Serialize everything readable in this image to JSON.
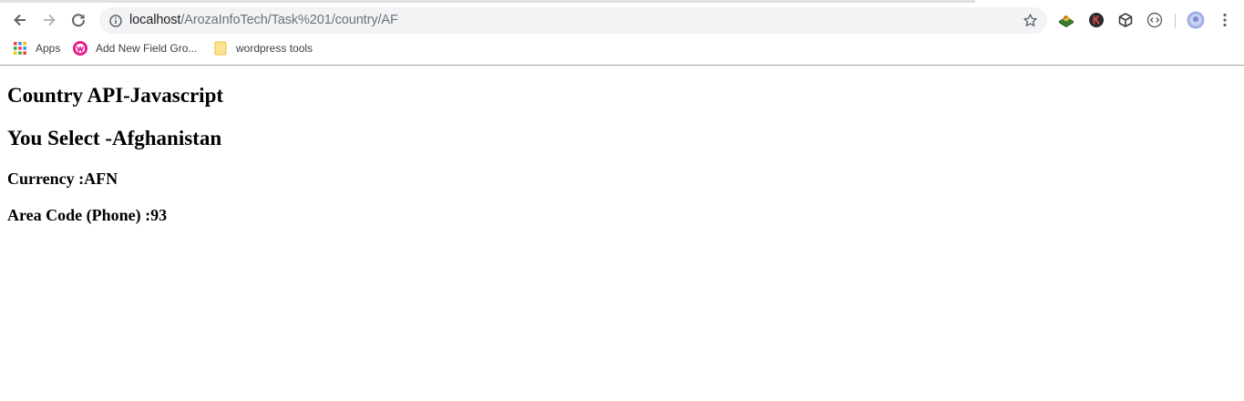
{
  "browser": {
    "url_host": "localhost",
    "url_path": "/ArozaInfoTech/Task%201/country/AF",
    "icons": {
      "back": "arrow-left-icon",
      "forward": "arrow-right-icon",
      "reload": "reload-icon",
      "info": "info-icon",
      "bookmark_star": "star-icon",
      "menu": "kebab-menu-icon"
    },
    "extensions": [
      "globe-extension-icon",
      "k-extension-icon",
      "cube-extension-icon",
      "code-extension-icon"
    ],
    "profile": "profile-avatar"
  },
  "bookmarks": [
    {
      "label": "Apps",
      "icon": "apps-grid-icon"
    },
    {
      "label": "Add New Field Gro...",
      "icon": "wordpress-icon"
    },
    {
      "label": "wordpress tools",
      "icon": "folder-icon"
    }
  ],
  "page": {
    "title": "Country API-Javascript",
    "selection_text": "You Select -Afghanistan",
    "currency_text": "Currency :AFN",
    "area_code_text": "Area Code (Phone) :93"
  }
}
